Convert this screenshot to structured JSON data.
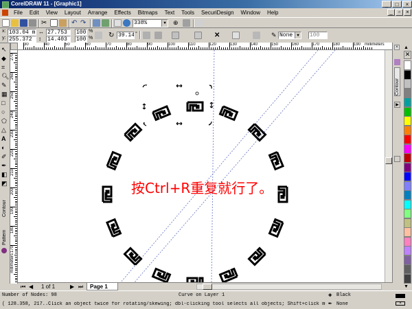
{
  "window": {
    "title": "CorelDRAW 11 - [Graphic1]"
  },
  "menu": {
    "items": [
      "File",
      "Edit",
      "View",
      "Layout",
      "Arrange",
      "Effects",
      "Bitmaps",
      "Text",
      "Tools",
      "SecuriDesign",
      "Window",
      "Help"
    ]
  },
  "toolbar": {
    "zoom": "338%"
  },
  "propbar": {
    "x": "103.04 m",
    "y": "255.372",
    "w": "27.753",
    "h": "14.403",
    "scale_w": "100",
    "scale_h": "100",
    "scale_unit": "%",
    "angle": "39.147",
    "angle_unit": "°",
    "outline": "None",
    "outline_width": "100"
  },
  "ruler": {
    "h_ticks": [
      "30",
      "40",
      "50",
      "60",
      "70",
      "80",
      "90",
      "100",
      "110",
      "120",
      "130",
      "140",
      "150",
      "160",
      "170",
      "180",
      "190"
    ],
    "unit": "millimeters",
    "v_ticks": [
      "270",
      "260",
      "250",
      "240",
      "230",
      "220",
      "210",
      "200",
      "190",
      "180",
      "170",
      "160"
    ],
    "v_unit": "millimeters"
  },
  "canvas": {
    "annotation": "按Ctrl+R重复就行了。",
    "annotation_color": "#ff0000"
  },
  "docker": {
    "tab": "Contour"
  },
  "toolbox_labels": {
    "contour": "Contour",
    "pattern": "Pattern"
  },
  "pages": {
    "counter": "1 of 1",
    "tab": "Page 1"
  },
  "status": {
    "nodes": "Number of Nodes: 98",
    "object": "Curve on Layer 1",
    "coords": "( 128.358, 217....",
    "hint": "Click an object twice for rotating/skewing; dbl-clicking tool selects all objects; Shift+click multi-selects; Al...",
    "fill": "Black",
    "outline": "None"
  },
  "palette": [
    "#ffffff",
    "#000000",
    "#c0c0c0",
    "#808080",
    "#00a0a0",
    "#00c000",
    "#ffff00",
    "#ff8000",
    "#ff0000",
    "#ff00ff",
    "#c00000",
    "#800080",
    "#0000ff",
    "#8080ff",
    "#0080c0",
    "#00ffff",
    "#80ff80",
    "#c0c080",
    "#ffc0a0",
    "#ff80c0",
    "#c080ff",
    "#8060a0",
    "#606060",
    "#404040"
  ]
}
